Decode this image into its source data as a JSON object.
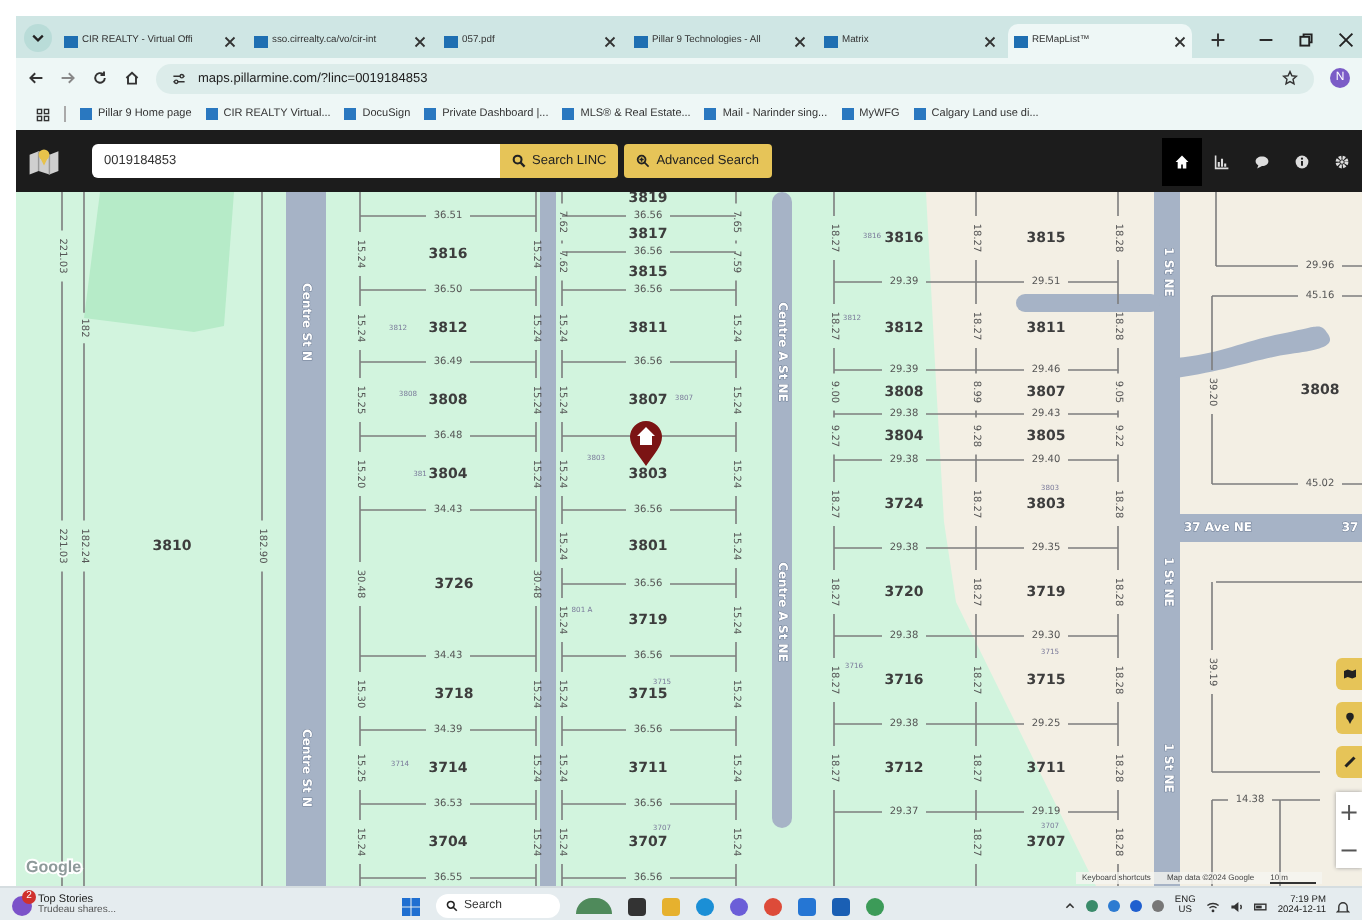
{
  "browser": {
    "tabs": [
      {
        "label": "CIR REALTY - Virtual Offi",
        "selected": false
      },
      {
        "label": "sso.cirrealty.ca/vo/cir-int",
        "selected": false
      },
      {
        "label": "057.pdf",
        "selected": false
      },
      {
        "label": "Pillar 9 Technologies - All",
        "selected": false
      },
      {
        "label": "Matrix",
        "selected": false
      },
      {
        "label": "REMapList™",
        "selected": true
      }
    ],
    "address": "maps.pillarmine.com/?linc=0019184853",
    "profile_initial": "N",
    "bookmarks": [
      "Pillar 9 Home page",
      "CIR REALTY Virtual...",
      "DocuSign",
      "Private Dashboard |...",
      "MLS® & Real Estate...",
      "Mail - Narinder sing...",
      "MyWFG",
      "Calgary Land use di..."
    ]
  },
  "app": {
    "search": {
      "value": "0019184853"
    },
    "buttons": [
      "Search LINC",
      "Advanced Search"
    ],
    "nav": [
      {
        "kind": "home",
        "selected": true
      },
      {
        "kind": "chart",
        "selected": false
      },
      {
        "kind": "chat",
        "selected": false
      },
      {
        "kind": "info",
        "selected": false
      },
      {
        "kind": "settings",
        "selected": false
      }
    ]
  },
  "map": {
    "streets": [
      "Centre St N",
      "Centre St N",
      "Centre A St NE",
      "Centre A St NE",
      "1 St NE",
      "1 St NE",
      "1 St NE",
      "37 Ave NE",
      "37"
    ],
    "lots": [
      "3816",
      "3812",
      "3808",
      "3804",
      "3726",
      "3718",
      "3714",
      "3704",
      "3819",
      "3817",
      "3815",
      "3811",
      "3807",
      "3803",
      "3801",
      "3719",
      "3715",
      "3711",
      "3707",
      "3810",
      "3816",
      "3812",
      "3808",
      "3804",
      "3724",
      "3720",
      "3716",
      "3712",
      "3815",
      "3811",
      "3807",
      "3805",
      "3803",
      "3719",
      "3715",
      "3711",
      "3707",
      "3808"
    ],
    "address_labels": [
      "3812",
      "3808",
      "381",
      "3803",
      "3807",
      "3714",
      "3715",
      "3707",
      "801 A",
      "3816",
      "3812",
      "3803",
      "3716",
      "3715",
      "3707"
    ],
    "dimensions_horizontal": [
      "36.51",
      "36.50",
      "36.49",
      "36.48",
      "34.43",
      "34.43",
      "34.39",
      "36.53",
      "36.55",
      "36.56",
      "36.56",
      "36.56",
      "36.56",
      "36.56",
      "36.56",
      "36.56",
      "36.56",
      "36.56",
      "36.56",
      "29.39",
      "29.39",
      "29.38",
      "29.38",
      "29.38",
      "29.38",
      "29.38",
      "29.37",
      "29.51",
      "29.46",
      "29.43",
      "29.40",
      "29.35",
      "29.30",
      "29.25",
      "29.19",
      "29.96",
      "45.16",
      "45.02",
      "14.38"
    ],
    "dimensions_vertical": [
      "15.24",
      "15.24",
      "15.25",
      "15.20",
      "30.48",
      "15.30",
      "15.25",
      "15.24",
      "15.24",
      "15.24",
      "15.24",
      "15.24",
      "30.48",
      "15.24",
      "15.24",
      "15.24",
      "7.62",
      "7.62",
      "15.24",
      "15.24",
      "15.24",
      "15.24",
      "15.24",
      "15.24",
      "15.24",
      "15.24",
      "7.65",
      "7.59",
      "15.24",
      "15.24",
      "15.24",
      "15.24",
      "15.24",
      "15.24",
      "15.24",
      "15.24",
      "18.27",
      "18.27",
      "9.00",
      "9.27",
      "18.27",
      "18.27",
      "18.27",
      "18.27",
      "18.27",
      "18.27",
      "8.99",
      "9.28",
      "18.27",
      "18.27",
      "18.27",
      "18.27",
      "18.27",
      "18.28",
      "18.28",
      "9.05",
      "9.22",
      "18.28",
      "18.28",
      "18.28",
      "18.28",
      "18.28",
      "221.03",
      "221.03",
      "182",
      "182.24",
      "182.90",
      "39.20",
      "39.19"
    ],
    "zoom_controls": [
      "+",
      "−"
    ],
    "logo": "Google",
    "attribution": [
      "Keyboard shortcuts",
      "Map data ©2024 Google",
      "10 m"
    ]
  },
  "taskbar": {
    "news": {
      "badge": "2",
      "title": "Top Stories",
      "subtitle": "Trudeau shares..."
    },
    "search": {
      "placeholder": "Search"
    },
    "language": [
      "ENG",
      "US"
    ],
    "time": "7:19 PM",
    "date": "2024-12-11"
  }
}
